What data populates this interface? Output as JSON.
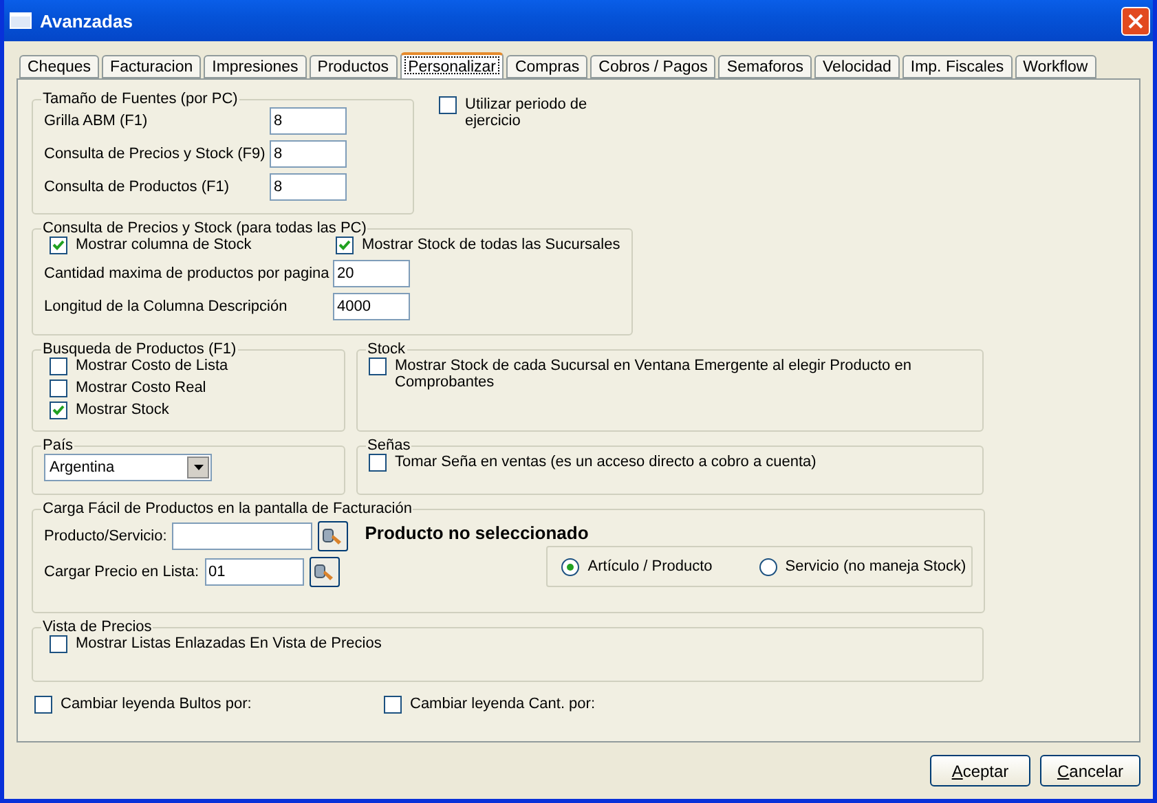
{
  "window": {
    "title": "Avanzadas"
  },
  "tabs": [
    {
      "label": "Cheques",
      "selected": false
    },
    {
      "label": "Facturacion",
      "selected": false
    },
    {
      "label": "Impresiones",
      "selected": false
    },
    {
      "label": "Productos",
      "selected": false
    },
    {
      "label": "Personalizar",
      "selected": true
    },
    {
      "label": "Compras",
      "selected": false
    },
    {
      "label": "Cobros / Pagos",
      "selected": false
    },
    {
      "label": "Semaforos",
      "selected": false
    },
    {
      "label": "Velocidad",
      "selected": false
    },
    {
      "label": "Imp. Fiscales",
      "selected": false
    },
    {
      "label": "Workflow",
      "selected": false
    }
  ],
  "font_sizes": {
    "title": "Tamaño de Fuentes (por PC)",
    "fields": [
      {
        "label": "Grilla ABM (F1)",
        "value": "8"
      },
      {
        "label": "Consulta de Precios y Stock (F9)",
        "value": "8"
      },
      {
        "label": "Consulta de Productos (F1)",
        "value": "8"
      }
    ]
  },
  "use_period": {
    "label": "Utilizar periodo de ejercicio",
    "checked": false
  },
  "price_query": {
    "title": "Consulta de Precios y Stock (para todas las PC)",
    "checks": [
      {
        "label": "Mostrar columna de Stock",
        "checked": true
      },
      {
        "label": "Mostrar Stock de todas las Sucursales",
        "checked": true
      }
    ],
    "fields": [
      {
        "label": "Cantidad maxima de productos por pagina",
        "value": "20"
      },
      {
        "label": "Longitud de la Columna Descripción",
        "value": "4000"
      }
    ]
  },
  "product_search": {
    "title": "Busqueda de Productos (F1)",
    "checks": [
      {
        "label": "Mostrar Costo de Lista",
        "checked": false
      },
      {
        "label": "Mostrar Costo Real",
        "checked": false
      },
      {
        "label": "Mostrar Stock",
        "checked": true
      }
    ]
  },
  "stock": {
    "title": "Stock",
    "checks": [
      {
        "label": "Mostrar Stock de cada Sucursal en Ventana Emergente al elegir Producto en Comprobantes",
        "checked": false
      }
    ]
  },
  "country": {
    "title": "País",
    "value": "Argentina"
  },
  "deposits": {
    "title": "Señas",
    "checks": [
      {
        "label": "Tomar Seña en ventas (es un acceso directo a cobro a cuenta)",
        "checked": false
      }
    ]
  },
  "quick_load": {
    "title": "Carga Fácil de Productos en la pantalla de Facturación",
    "product_label": "Producto/Servicio:",
    "product_status": "Producto no seleccionado",
    "price_list_label": "Cargar Precio en Lista:",
    "price_list_value": "01",
    "types": [
      {
        "label": "Artículo / Producto",
        "selected": true
      },
      {
        "label": "Servicio (no maneja Stock)",
        "selected": false
      }
    ]
  },
  "price_view": {
    "title": "Vista de Precios",
    "checks": [
      {
        "label": "Mostrar Listas Enlazadas En Vista de Precios",
        "checked": false
      }
    ]
  },
  "legend_options": [
    {
      "label": "Cambiar leyenda Bultos por:",
      "checked": false
    },
    {
      "label": "Cambiar leyenda Cant. por:",
      "checked": false
    }
  ],
  "buttons": [
    "Aceptar",
    "Cancelar"
  ]
}
